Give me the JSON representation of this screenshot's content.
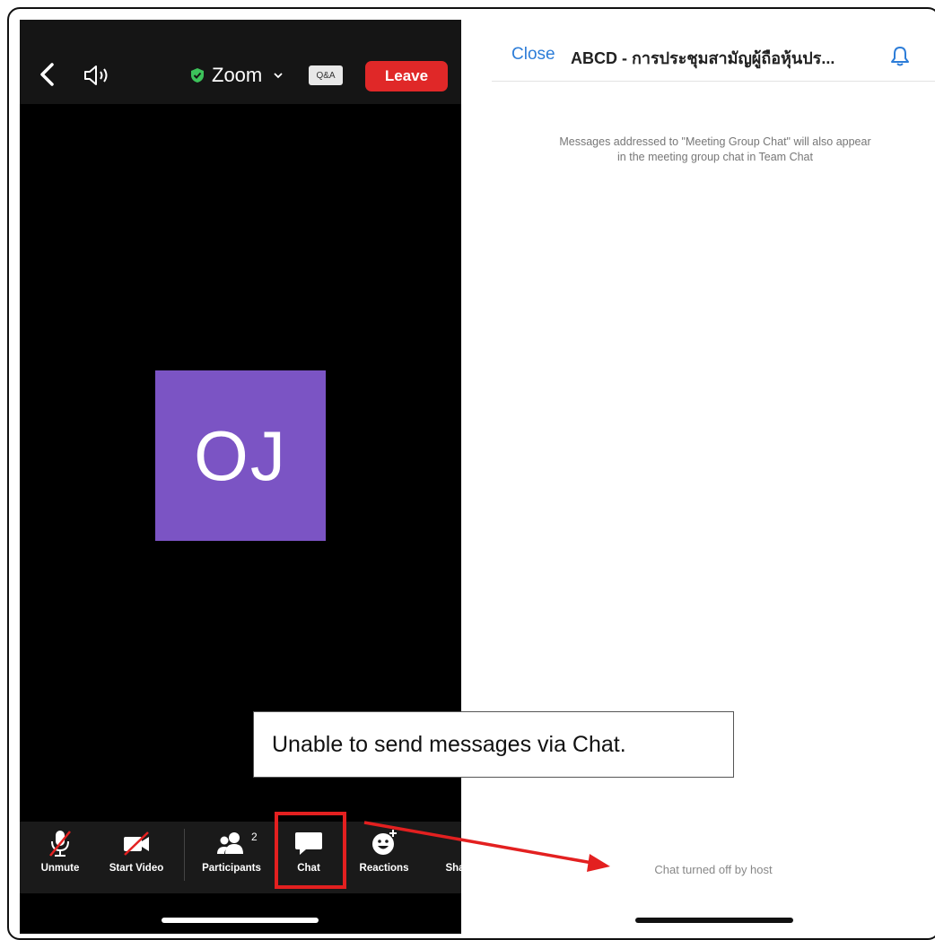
{
  "meeting": {
    "title": "Zoom",
    "qa_label": "Q&A",
    "leave_label": "Leave",
    "avatar_initials": "OJ"
  },
  "toolbar": {
    "items": [
      {
        "label": "Unmute",
        "icon": "mic-off-icon"
      },
      {
        "label": "Start Video",
        "icon": "video-off-icon"
      },
      {
        "label": "Participants",
        "icon": "participants-icon"
      },
      {
        "label": "Chat",
        "icon": "chat-icon"
      },
      {
        "label": "Reactions",
        "icon": "reactions-icon"
      },
      {
        "label": "Sha",
        "icon": "share-icon"
      }
    ],
    "participant_count": "2"
  },
  "chat": {
    "close_label": "Close",
    "title": "ABCD - การประชุมสามัญผู้ถือหุ้นปร...",
    "notice_line1": "Messages addressed to \"Meeting Group Chat\" will also appear",
    "notice_line2": "in the meeting group chat in Team Chat",
    "disabled_text": "Chat turned off by host"
  },
  "annotation": {
    "callout_text": "Unable to send messages via Chat."
  },
  "colors": {
    "leave_red": "#e02828",
    "avatar_purple": "#7b54c4",
    "link_blue": "#2d7dd8",
    "annotation_red": "#e32020",
    "shield_green": "#3cc25a"
  }
}
